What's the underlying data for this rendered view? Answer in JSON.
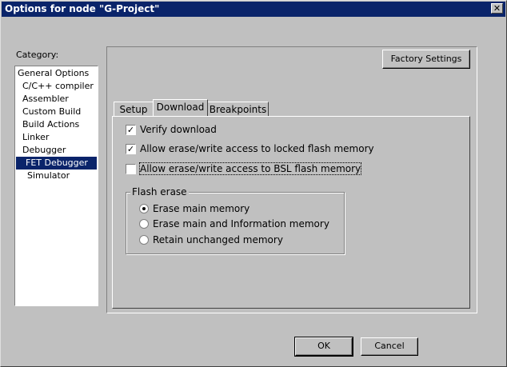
{
  "window": {
    "title": "Options for node \"G-Project\"",
    "close_label": "✕"
  },
  "category": {
    "label": "Category:",
    "items": [
      {
        "label": "General Options",
        "indent": 0,
        "selected": false
      },
      {
        "label": "C/C++ compiler",
        "indent": 1,
        "selected": false
      },
      {
        "label": "Assembler",
        "indent": 1,
        "selected": false
      },
      {
        "label": "Custom Build",
        "indent": 1,
        "selected": false
      },
      {
        "label": "Build Actions",
        "indent": 1,
        "selected": false
      },
      {
        "label": "Linker",
        "indent": 1,
        "selected": false
      },
      {
        "label": "Debugger",
        "indent": 1,
        "selected": false
      },
      {
        "label": "FET Debugger",
        "indent": 2,
        "selected": true
      },
      {
        "label": "Simulator",
        "indent": 2,
        "selected": false
      }
    ]
  },
  "panel": {
    "factory_settings_label": "Factory Settings",
    "tabs": [
      {
        "label": "Setup",
        "active": false
      },
      {
        "label": "Download",
        "active": true
      },
      {
        "label": "Breakpoints",
        "active": false
      }
    ],
    "download": {
      "options": [
        {
          "label": "Verify download",
          "checked": true
        },
        {
          "label": "Allow erase/write access to locked flash memory",
          "checked": true
        },
        {
          "label": "Allow erase/write access to BSL flash memory",
          "checked": false
        }
      ],
      "flash_erase": {
        "title": "Flash erase",
        "choices": [
          {
            "label": "Erase main memory",
            "selected": true
          },
          {
            "label": "Erase main and Information memory",
            "selected": false
          },
          {
            "label": "Retain unchanged memory",
            "selected": false
          }
        ]
      }
    }
  },
  "footer": {
    "ok_label": "OK",
    "cancel_label": "Cancel"
  }
}
